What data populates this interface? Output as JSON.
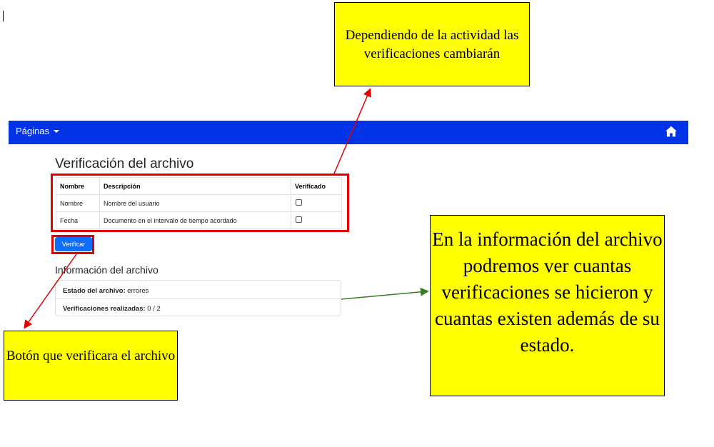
{
  "navbar": {
    "menu_label": "Páginas",
    "home_icon": "home-icon",
    "color": "#0033e6"
  },
  "section": {
    "title": "Verificación del archivo"
  },
  "table": {
    "headers": [
      "Nombre",
      "Descripción",
      "Verificado"
    ],
    "rows": [
      {
        "name": "Nombre",
        "description": "Nombre del usuario",
        "verified": false
      },
      {
        "name": "Fecha",
        "description": "Documento en el intervalo de tiempo acordado",
        "verified": false
      }
    ]
  },
  "verify_button": {
    "label": "Verificar",
    "color": "#0d6efd"
  },
  "info": {
    "title": "Información del archivo",
    "status_label": "Estado del archivo:",
    "status_value": "errores",
    "count_label": "Verificaciones realizadas:",
    "count_value": "0 / 2"
  },
  "annotations": {
    "note_top": "Dependiendo de la actividad las verificaciones cambiarán",
    "note_right": "En la información del archivo podremos ver cuantas verificaciones se hicieron y cuantas existen además de su estado.",
    "note_bottom_left": "Botón que verificara el archivo",
    "note_color": "#ffff00",
    "highlight_color": "#e00000",
    "arrow_color_red": "#e00000",
    "arrow_color_green": "#3a7d22"
  }
}
